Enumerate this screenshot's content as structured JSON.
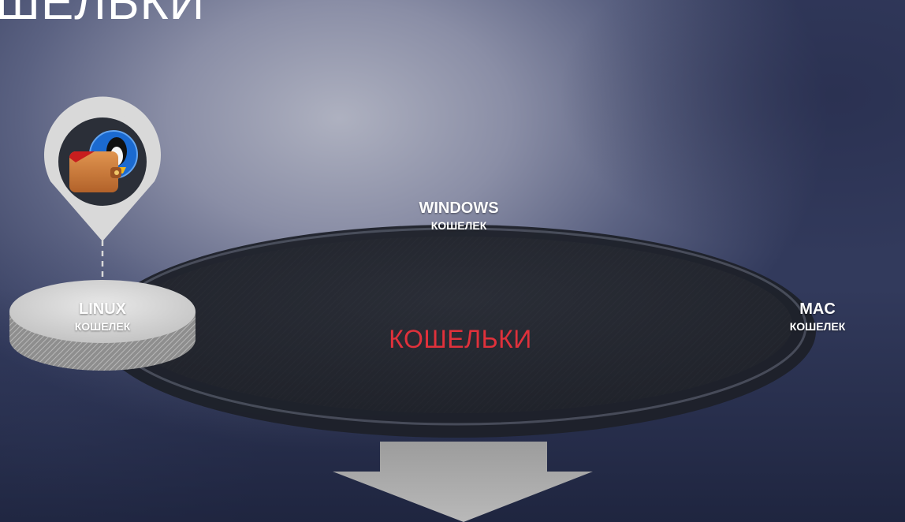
{
  "header": {
    "title": "ШЕЛЬКИ"
  },
  "center": {
    "label": "КОШЕЛЬКИ"
  },
  "nodes": [
    {
      "id": "linux",
      "title": "LINUX",
      "subtitle": "КОШЕЛЕК",
      "icon": "linux-wallet-icon"
    },
    {
      "id": "windows",
      "title": "WINDOWS",
      "subtitle": "КОШЕЛЕК",
      "icon": "windows-wallet-icon"
    },
    {
      "id": "mac",
      "title": "MAC",
      "subtitle": "КОШЕЛЕК",
      "icon": "mac-wallet-icon"
    }
  ],
  "colors": {
    "accent_text": "#e0313b",
    "platform_dark": "#23262e",
    "ring_dark": "#1e2129",
    "disc_top": "#d6d6d6",
    "disc_side": "#9a9a9a",
    "pin": "#d9d9d9",
    "pin_inner": "#2b2f38",
    "wallet": "#c9773a",
    "arrow": "#a9a9a9"
  }
}
